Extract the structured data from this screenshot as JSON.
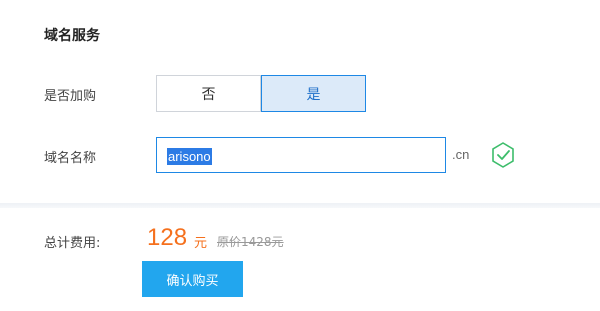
{
  "section": {
    "title": "域名服务"
  },
  "purchase": {
    "label": "是否加购",
    "options": [
      "否",
      "是"
    ],
    "selected": "是"
  },
  "domain": {
    "label": "域名名称",
    "value": "arisono",
    "suffix": ".cn",
    "valid_icon": "check-shield-icon"
  },
  "total": {
    "label": "总计费用:",
    "price": "128",
    "currency": "元",
    "original": "原价1428元"
  },
  "actions": {
    "buy_label": "确认购买"
  },
  "colors": {
    "accent": "#1e88e5",
    "price": "#f5701d",
    "button": "#22a6ee",
    "success": "#3dbd6b"
  }
}
